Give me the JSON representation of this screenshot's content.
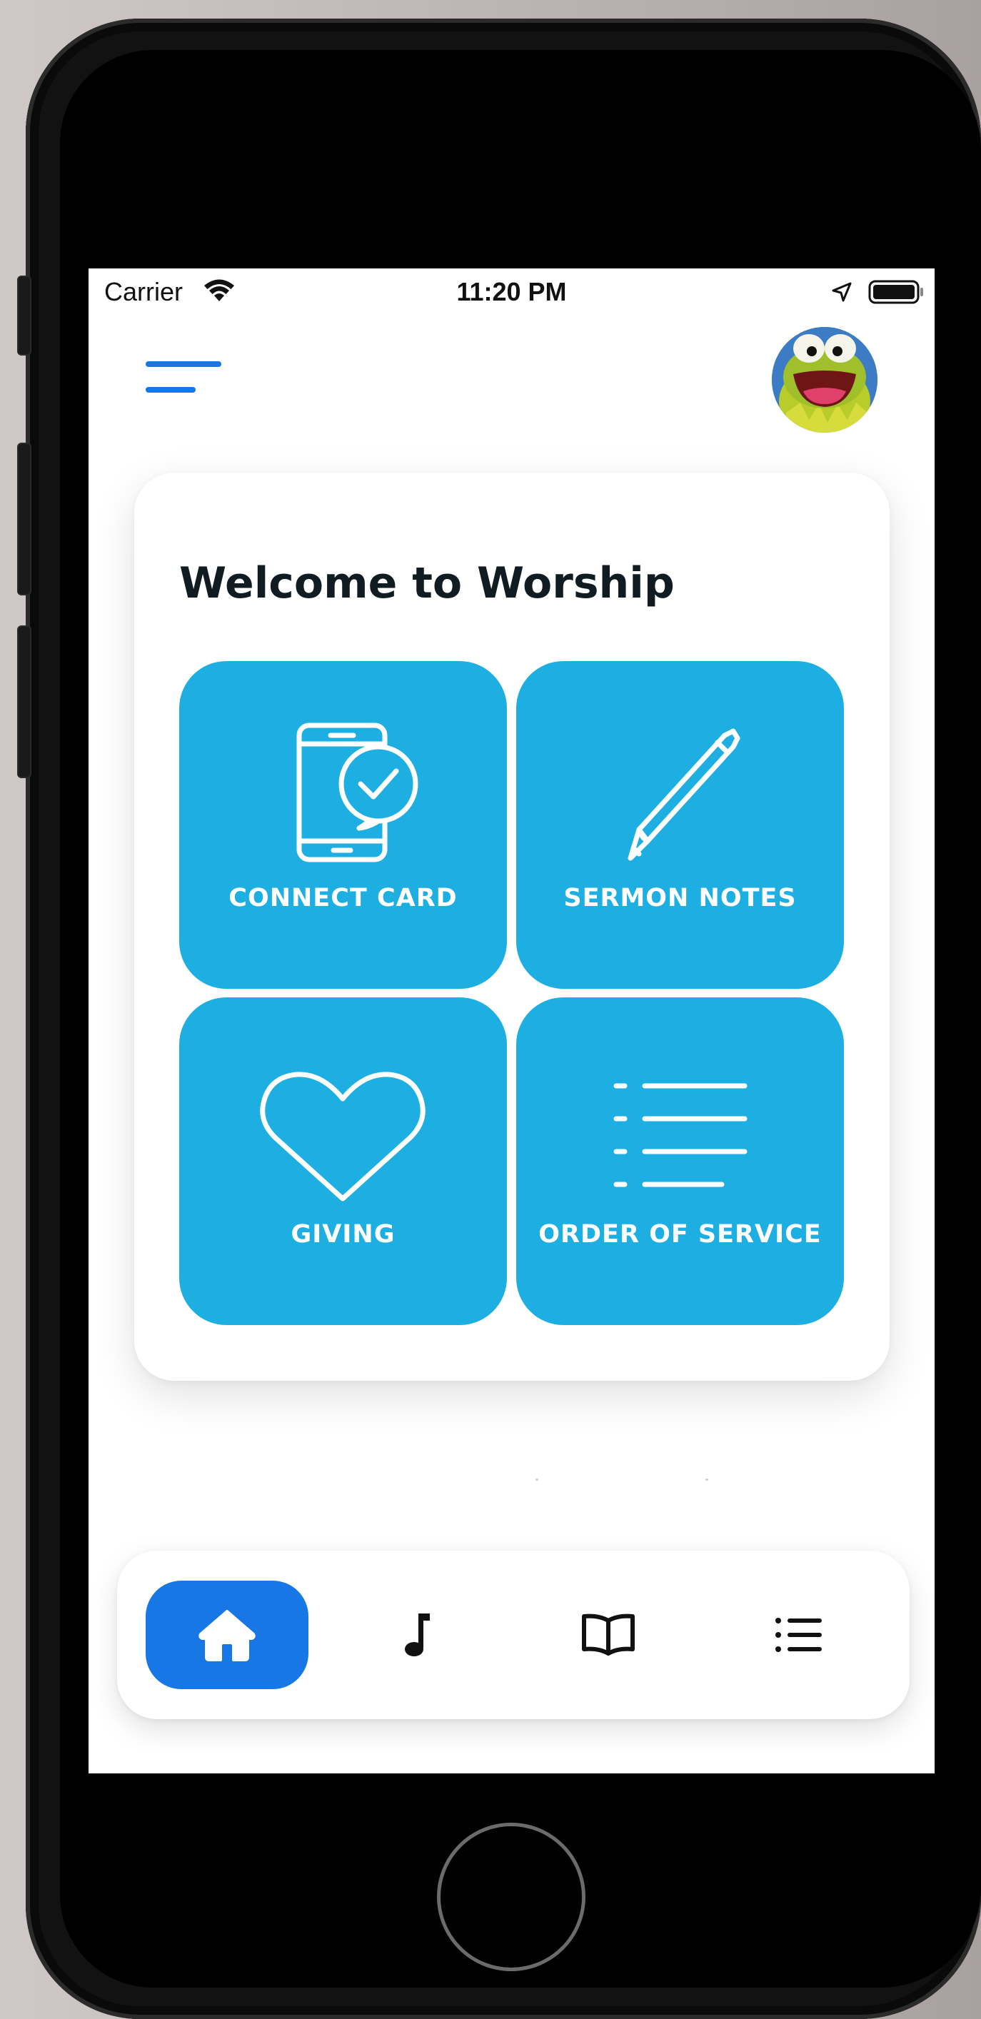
{
  "status_bar": {
    "carrier": "Carrier",
    "time": "11:20 PM",
    "icons": [
      "wifi-icon",
      "location-arrow-icon",
      "battery-icon"
    ]
  },
  "header": {
    "menu_icon": "hamburger-menu-icon",
    "avatar": "user-avatar-frog"
  },
  "welcome_card": {
    "title": "Welcome to Worship",
    "tiles": [
      {
        "label": "CONNECT CARD",
        "icon": "phone-check-icon"
      },
      {
        "label": "SERMON NOTES",
        "icon": "pencil-icon"
      },
      {
        "label": "GIVING",
        "icon": "heart-icon"
      },
      {
        "label": "ORDER OF SERVICE",
        "icon": "list-icon"
      }
    ]
  },
  "bottom_nav": {
    "items": [
      {
        "icon": "home-icon",
        "active": true
      },
      {
        "icon": "music-note-icon",
        "active": false
      },
      {
        "icon": "open-book-icon",
        "active": false
      },
      {
        "icon": "list-icon",
        "active": false
      }
    ]
  },
  "colors": {
    "tile_blue": "#1daee2",
    "accent_blue": "#1677e5",
    "title_text": "#101c22",
    "screen_bg": "#ffffff"
  }
}
